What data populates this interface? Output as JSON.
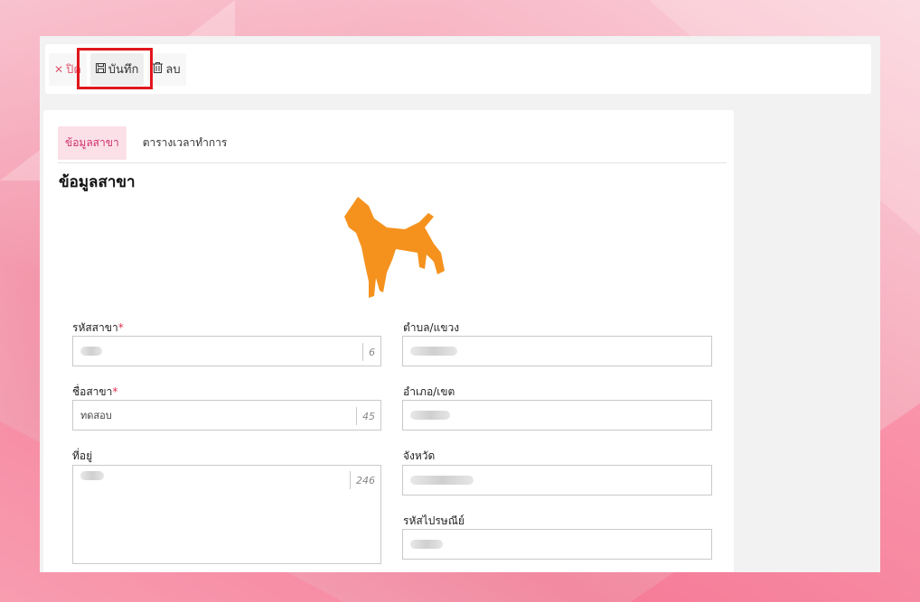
{
  "toolbar": {
    "close_label": "ปิด",
    "save_label": "บันทึก",
    "delete_label": "ลบ"
  },
  "tabs": [
    {
      "label": "ข้อมูลสาขา",
      "active": true
    },
    {
      "label": "ตารางเวลาทำการ",
      "active": false
    }
  ],
  "section_title": "ข้อมูลสาขา",
  "logo_color": "#f5921e",
  "form": {
    "branch_code": {
      "label": "รหัสสาขา",
      "required": "*",
      "value": "",
      "counter": "6"
    },
    "branch_name": {
      "label": "ชื่อสาขา",
      "required": "*",
      "value": "ทดสอบ",
      "counter": "45"
    },
    "address": {
      "label": "ที่อยู่",
      "value": "",
      "counter": "246"
    },
    "subdistrict": {
      "label": "ตำบล/แขวง",
      "value": ""
    },
    "district": {
      "label": "อำเภอ/เขต",
      "value": ""
    },
    "province": {
      "label": "จังหวัด",
      "value": ""
    },
    "postal_code": {
      "label": "รหัสไปรษณีย์",
      "value": ""
    }
  },
  "colors": {
    "accent": "#d0326b",
    "tab_active_bg": "#fbe0e8",
    "highlight": "#e0161c"
  }
}
